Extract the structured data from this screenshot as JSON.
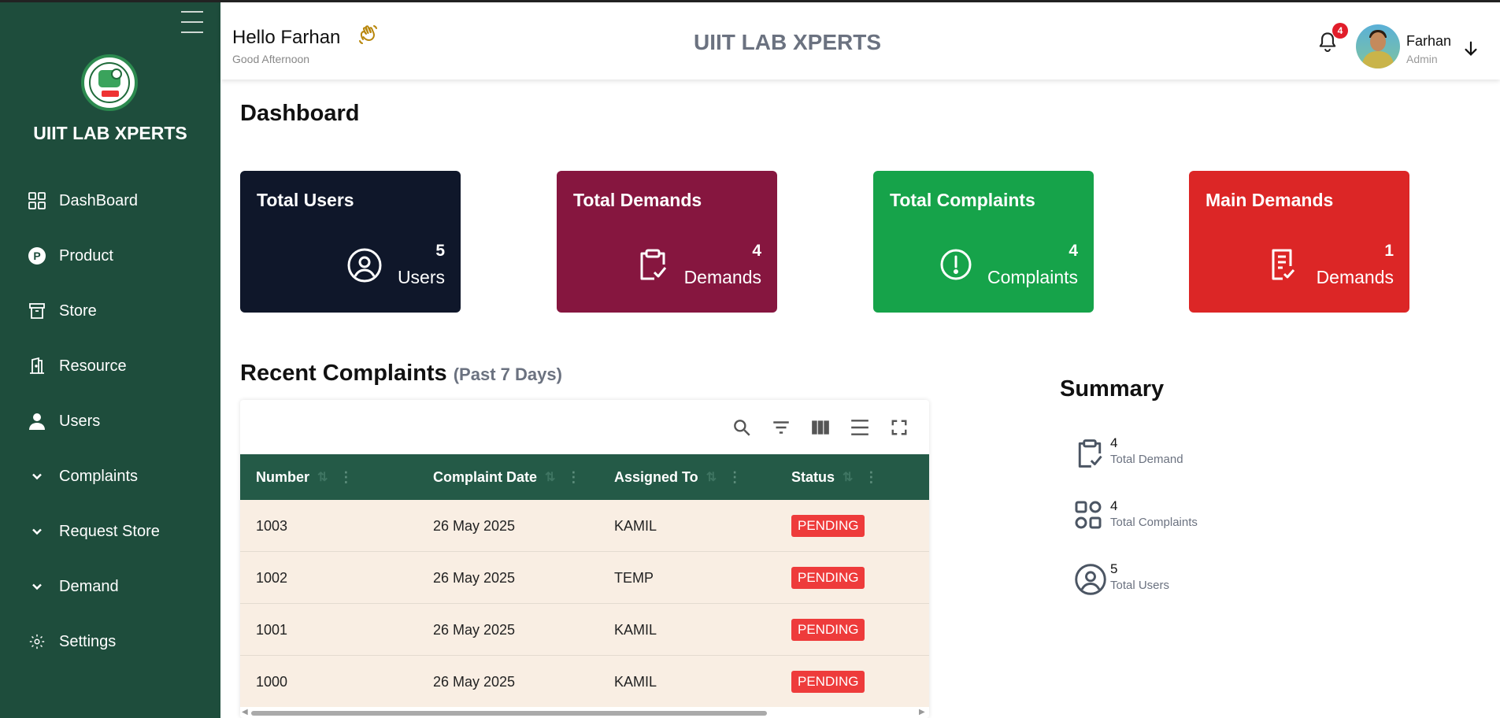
{
  "app": {
    "brand": "UIIT LAB XPERTS"
  },
  "sidebar": {
    "items": [
      {
        "label": "DashBoard",
        "icon": "grid-icon"
      },
      {
        "label": "Product",
        "icon": "product-p-icon"
      },
      {
        "label": "Store",
        "icon": "archive-box-icon"
      },
      {
        "label": "Resource",
        "icon": "door-icon"
      },
      {
        "label": "Users",
        "icon": "user-icon"
      },
      {
        "label": "Complaints",
        "icon": "chevron-down-icon"
      },
      {
        "label": "Request Store",
        "icon": "chevron-down-icon"
      },
      {
        "label": "Demand",
        "icon": "chevron-down-icon"
      },
      {
        "label": "Settings",
        "icon": "gear-icon"
      }
    ]
  },
  "header": {
    "greeting": "Hello Farhan",
    "subgreeting": "Good Afternoon",
    "title": "UIIT LAB XPERTS",
    "notification_count": "4",
    "user_name": "Farhan",
    "user_role": "Admin"
  },
  "main": {
    "title": "Dashboard",
    "cards": [
      {
        "title": "Total Users",
        "count": "5",
        "unit": "Users",
        "color": "#0f172a",
        "icon": "user-circle-icon"
      },
      {
        "title": "Total Demands",
        "count": "4",
        "unit": "Demands",
        "color": "#86163f",
        "icon": "clipboard-check-icon"
      },
      {
        "title": "Total Complaints",
        "count": "4",
        "unit": "Complaints",
        "color": "#16a34a",
        "icon": "alert-circle-icon"
      },
      {
        "title": "Main Demands",
        "count": "1",
        "unit": "Demands",
        "color": "#dc2626",
        "icon": "document-check-icon"
      }
    ],
    "recent": {
      "title": "Recent Complaints",
      "subtitle": "(Past 7 Days)",
      "columns": [
        "Number",
        "Complaint Date",
        "Assigned To",
        "Status"
      ],
      "rows": [
        {
          "number": "1003",
          "date": "26 May 2025",
          "assigned": "KAMIL",
          "status": "PENDING"
        },
        {
          "number": "1002",
          "date": "26 May 2025",
          "assigned": "TEMP",
          "status": "PENDING"
        },
        {
          "number": "1001",
          "date": "26 May 2025",
          "assigned": "KAMIL",
          "status": "PENDING"
        },
        {
          "number": "1000",
          "date": "26 May 2025",
          "assigned": "KAMIL",
          "status": "PENDING"
        }
      ]
    },
    "summary": {
      "title": "Summary",
      "items": [
        {
          "value": "4",
          "label": "Total Demand",
          "icon": "clipboard-check-icon"
        },
        {
          "value": "4",
          "label": "Total Complaints",
          "icon": "grid-squares-icon"
        },
        {
          "value": "5",
          "label": "Total Users",
          "icon": "user-circle-icon"
        }
      ]
    }
  },
  "colors": {
    "sidebar": "#1e4d3c",
    "table_header": "#245a47",
    "row_bg": "#f9eee3",
    "pending": "#ee3b3b"
  }
}
